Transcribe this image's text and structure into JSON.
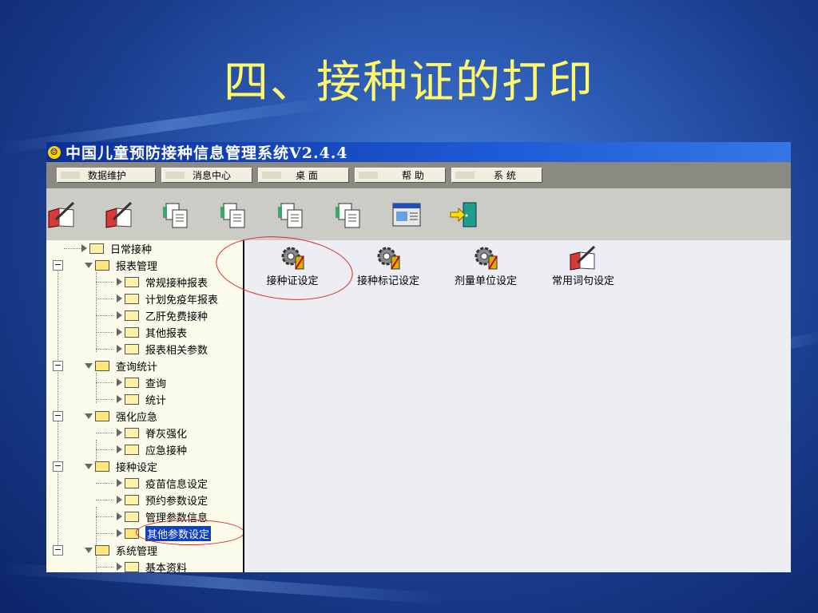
{
  "slide": {
    "title": "四、接种证的打印"
  },
  "window": {
    "title": "中国儿童预防接种信息管理系统V2.4.4"
  },
  "menu": [
    {
      "label": "数据维护"
    },
    {
      "label": "消息中心"
    },
    {
      "label": "桌 面"
    },
    {
      "label": "帮 助"
    },
    {
      "label": "系 统"
    }
  ],
  "toolbar": [
    {
      "icon": "book-pen-icon"
    },
    {
      "icon": "book-pen-icon"
    },
    {
      "icon": "copy-doc-icon"
    },
    {
      "icon": "copy-doc-icon"
    },
    {
      "icon": "copy-doc-icon"
    },
    {
      "icon": "copy-doc-icon"
    },
    {
      "icon": "window-form-icon"
    },
    {
      "icon": "exit-door-icon"
    }
  ],
  "tree": [
    {
      "label": "日常接种",
      "level": 1,
      "expanded": false
    },
    {
      "label": "报表管理",
      "level": 1,
      "expanded": true
    },
    {
      "label": "常规接种报表",
      "level": 2
    },
    {
      "label": "计划免疫年报表",
      "level": 2
    },
    {
      "label": "乙肝免费接种",
      "level": 2
    },
    {
      "label": "其他报表",
      "level": 2
    },
    {
      "label": "报表相关参数",
      "level": 2
    },
    {
      "label": "查询统计",
      "level": 1,
      "expanded": true
    },
    {
      "label": "查询",
      "level": 2
    },
    {
      "label": "统计",
      "level": 2
    },
    {
      "label": "强化应急",
      "level": 1,
      "expanded": true
    },
    {
      "label": "脊灰强化",
      "level": 2
    },
    {
      "label": "应急接种",
      "level": 2
    },
    {
      "label": "接种设定",
      "level": 1,
      "expanded": true
    },
    {
      "label": "疫苗信息设定",
      "level": 2
    },
    {
      "label": "预约参数设定",
      "level": 2
    },
    {
      "label": "管理参数信息",
      "level": 2
    },
    {
      "label": "其他参数设定",
      "level": 2,
      "selected": true
    },
    {
      "label": "系统管理",
      "level": 1,
      "expanded": true
    },
    {
      "label": "基本资料",
      "level": 2
    }
  ],
  "items": [
    {
      "label": "接种证设定",
      "icon": "gear-settings-icon"
    },
    {
      "label": "接种标记设定",
      "icon": "gear-settings-icon"
    },
    {
      "label": "剂量单位设定",
      "icon": "gear-settings-icon"
    },
    {
      "label": "常用词句设定",
      "icon": "book-pen-icon"
    }
  ]
}
